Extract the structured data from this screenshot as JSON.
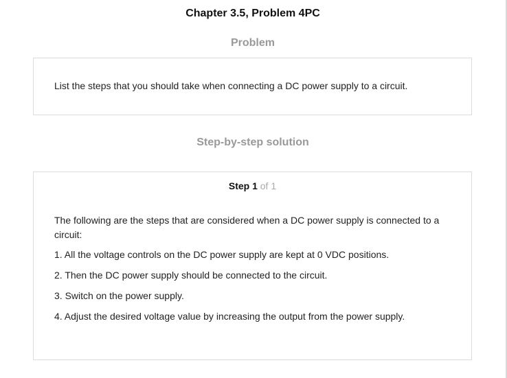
{
  "chapter_title": "Chapter 3.5, Problem 4PC",
  "problem": {
    "heading": "Problem",
    "text": "List the steps that you should take when connecting a DC power supply to a circuit."
  },
  "solution": {
    "heading": "Step-by-step solution",
    "step_label": "Step 1",
    "step_of": "of 1",
    "intro": "The following are the steps that are considered when a DC power supply is connected to a circuit:",
    "steps": [
      "1. All the voltage controls on the DC power supply are kept at 0 VDC positions.",
      "2. Then the DC power supply should be connected to the circuit.",
      "3. Switch on the power supply.",
      "4. Adjust the desired voltage value by increasing the output from the power supply."
    ]
  }
}
